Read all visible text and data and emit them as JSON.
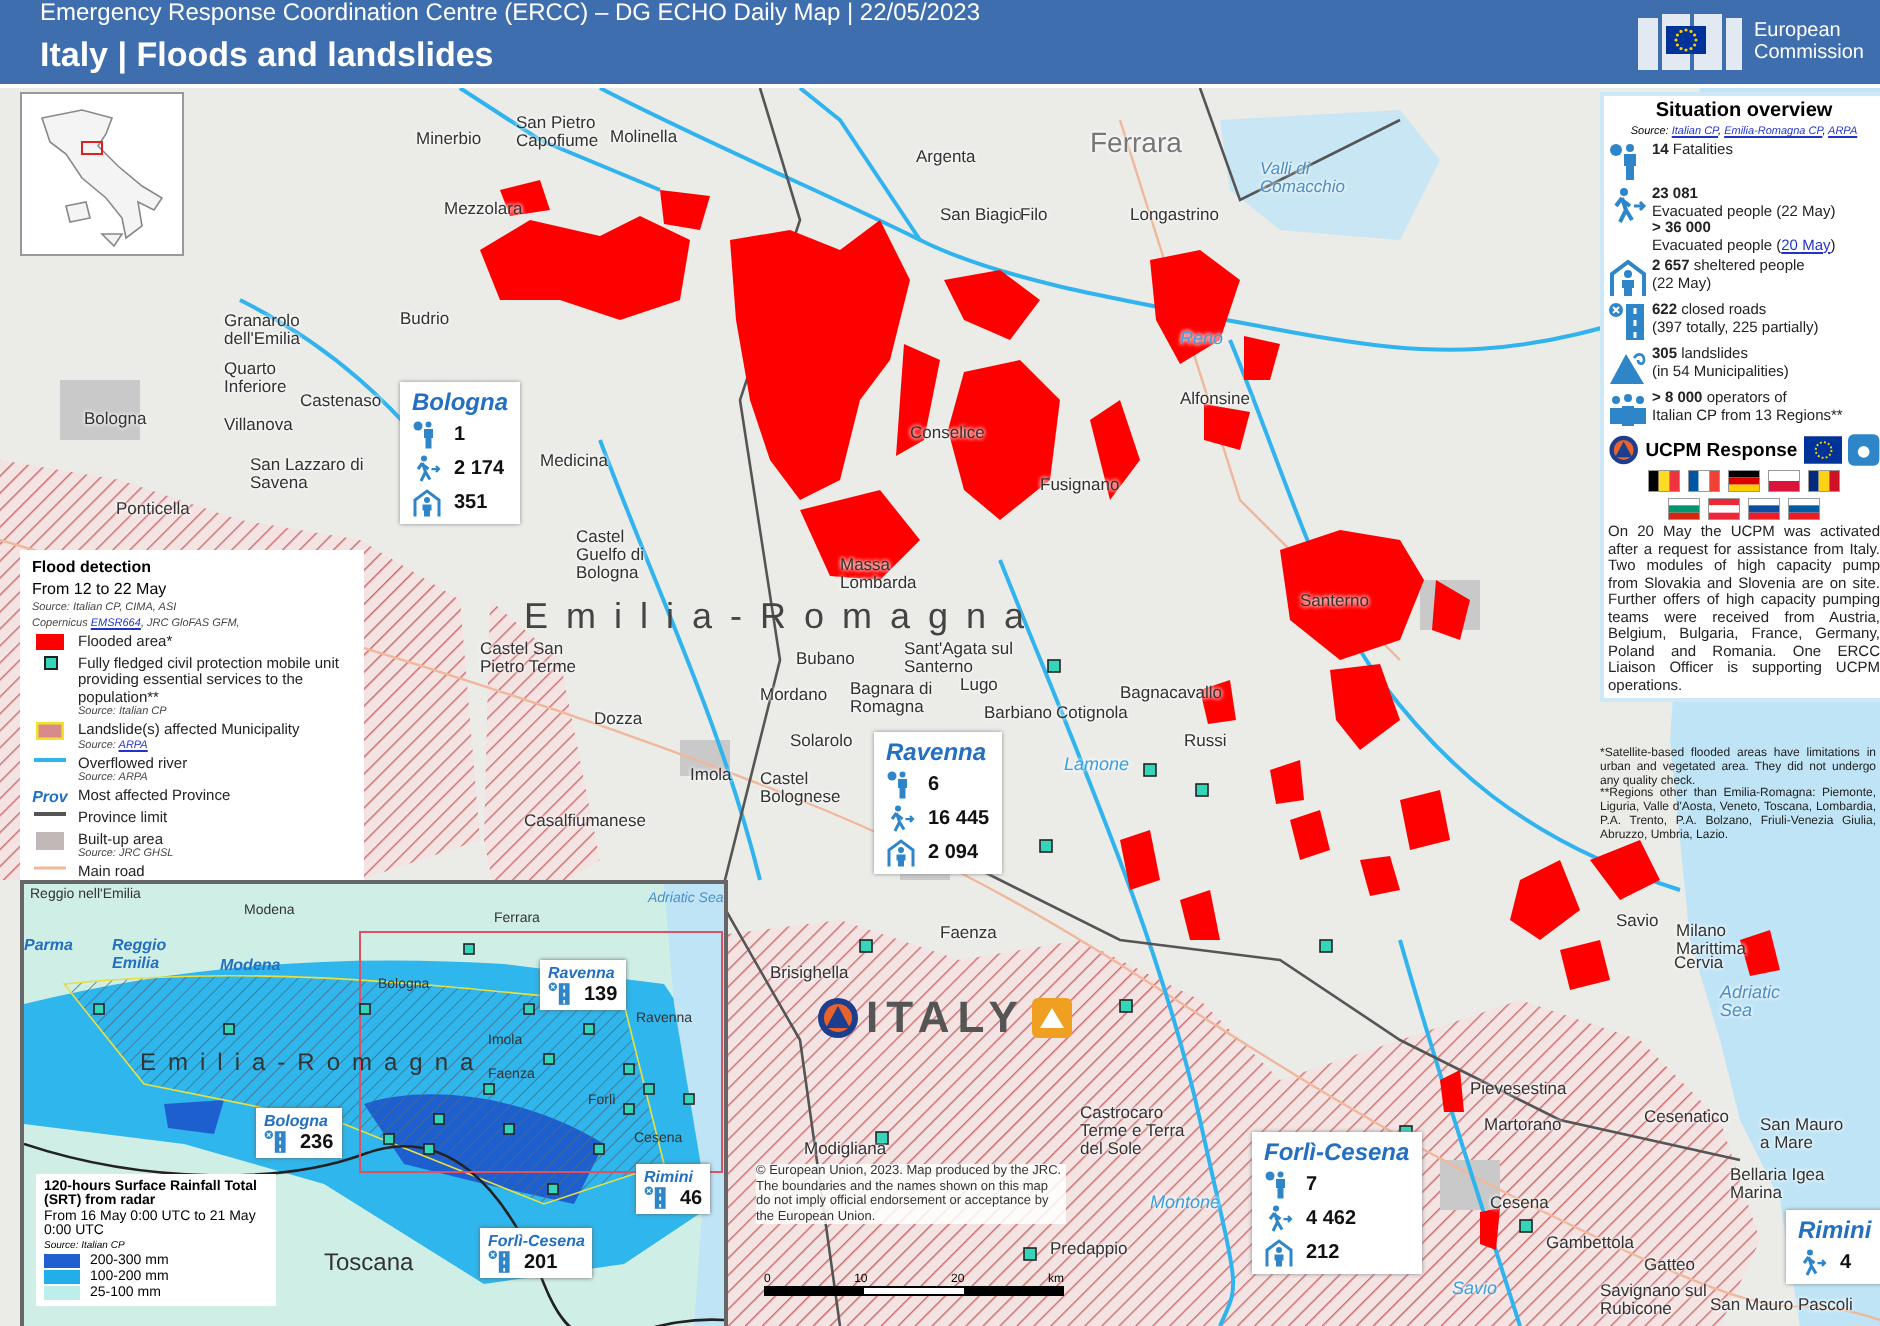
{
  "header": {
    "subtitle": "Emergency Response Coordination Centre (ERCC) – DG ECHO Daily Map | 22/05/2023",
    "title": "Italy | Floods and landslides",
    "logo_lines": [
      "European",
      "Commission"
    ]
  },
  "map": {
    "region_label": "Emilia-Romagna",
    "country_label": "ITALY",
    "places": [
      {
        "name": "Minerbio",
        "kind": "town"
      },
      {
        "name": "San Pietro Capofiume",
        "kind": "town"
      },
      {
        "name": "Molinella",
        "kind": "town"
      },
      {
        "name": "Argenta",
        "kind": "town"
      },
      {
        "name": "Ferrara",
        "kind": "city"
      },
      {
        "name": "Valli di Comacchio",
        "kind": "water"
      },
      {
        "name": "Mezzolara",
        "kind": "town"
      },
      {
        "name": "San Biagio",
        "kind": "town"
      },
      {
        "name": "Filo",
        "kind": "town"
      },
      {
        "name": "Longastrino",
        "kind": "town"
      },
      {
        "name": "Granarolo dell'Emilia",
        "kind": "town"
      },
      {
        "name": "Budrio",
        "kind": "town"
      },
      {
        "name": "Reno",
        "kind": "river"
      },
      {
        "name": "Quarto Inferiore",
        "kind": "town"
      },
      {
        "name": "Bologna",
        "kind": "town"
      },
      {
        "name": "Villanova",
        "kind": "town"
      },
      {
        "name": "Castenaso",
        "kind": "town"
      },
      {
        "name": "Conselice",
        "kind": "town"
      },
      {
        "name": "Alfonsine",
        "kind": "town"
      },
      {
        "name": "San Lazzaro di Savena",
        "kind": "town"
      },
      {
        "name": "Medicina",
        "kind": "town"
      },
      {
        "name": "Fusignano",
        "kind": "town"
      },
      {
        "name": "Ponticella",
        "kind": "town"
      },
      {
        "name": "Castel Guelfo di Bologna",
        "kind": "town"
      },
      {
        "name": "Massa Lombarda",
        "kind": "town"
      },
      {
        "name": "Santerno",
        "kind": "town"
      },
      {
        "name": "Castel San Pietro Terme",
        "kind": "town"
      },
      {
        "name": "Bubano",
        "kind": "town"
      },
      {
        "name": "Sant'Agata sul Santerno",
        "kind": "town"
      },
      {
        "name": "Mordano",
        "kind": "town"
      },
      {
        "name": "Bagnara di Romagna",
        "kind": "town"
      },
      {
        "name": "Lugo",
        "kind": "town"
      },
      {
        "name": "Bagnacavallo",
        "kind": "town"
      },
      {
        "name": "Dozza",
        "kind": "town"
      },
      {
        "name": "Barbiano",
        "kind": "town"
      },
      {
        "name": "Cotignola",
        "kind": "town"
      },
      {
        "name": "Solarolo",
        "kind": "town"
      },
      {
        "name": "Russi",
        "kind": "town"
      },
      {
        "name": "Lamone",
        "kind": "river"
      },
      {
        "name": "Imola",
        "kind": "town"
      },
      {
        "name": "Castel Bolognese",
        "kind": "town"
      },
      {
        "name": "Casalfiumanese",
        "kind": "town"
      },
      {
        "name": "Faenza",
        "kind": "town"
      },
      {
        "name": "Savio",
        "kind": "town"
      },
      {
        "name": "Milano Marittima",
        "kind": "town"
      },
      {
        "name": "Brisighella",
        "kind": "town"
      },
      {
        "name": "Cervia",
        "kind": "town"
      },
      {
        "name": "Adriatic Sea",
        "kind": "sea"
      },
      {
        "name": "Pievesestina",
        "kind": "town"
      },
      {
        "name": "Castrocaro Terme e Terra del Sole",
        "kind": "town"
      },
      {
        "name": "Martorano",
        "kind": "town"
      },
      {
        "name": "Cesenatico",
        "kind": "town"
      },
      {
        "name": "San Mauro a Mare",
        "kind": "town"
      },
      {
        "name": "Modigliana",
        "kind": "town"
      },
      {
        "name": "Bellaria Igea Marina",
        "kind": "town"
      },
      {
        "name": "Montone",
        "kind": "river"
      },
      {
        "name": "Cesena",
        "kind": "town"
      },
      {
        "name": "Predappio",
        "kind": "town"
      },
      {
        "name": "Gambettola",
        "kind": "town"
      },
      {
        "name": "Gatteo",
        "kind": "town"
      },
      {
        "name": "Savio",
        "kind": "river"
      },
      {
        "name": "Savignano sul Rubicone",
        "kind": "town"
      },
      {
        "name": "San Mauro Pascoli",
        "kind": "town"
      }
    ]
  },
  "provinces": [
    {
      "name": "Bologna",
      "stats": [
        {
          "kind": "fatalities",
          "value": "1"
        },
        {
          "kind": "evacuated",
          "value": "2 174"
        },
        {
          "kind": "sheltered",
          "value": "351"
        }
      ]
    },
    {
      "name": "Ravenna",
      "stats": [
        {
          "kind": "fatalities",
          "value": "6"
        },
        {
          "kind": "evacuated",
          "value": "16 445"
        },
        {
          "kind": "sheltered",
          "value": "2 094"
        }
      ]
    },
    {
      "name": "Forlì-Cesena",
      "stats": [
        {
          "kind": "fatalities",
          "value": "7"
        },
        {
          "kind": "evacuated",
          "value": "4 462"
        },
        {
          "kind": "sheltered",
          "value": "212"
        }
      ]
    },
    {
      "name": "Rimini",
      "stats": [
        {
          "kind": "evacuated",
          "value": "4"
        }
      ]
    }
  ],
  "legend": {
    "title": "Flood detection",
    "subtitle": "From 12 to 22 May",
    "sources": [
      [
        {
          "text": "Source: Italian CP, CIMA, ASI"
        }
      ],
      [
        {
          "text": "Copernicus "
        },
        {
          "text": "EMSR664",
          "kind": "link"
        },
        {
          "text": ", JRC GloFAS GFM,"
        }
      ]
    ],
    "items": [
      {
        "kind": "flood",
        "label": "Flooded area*"
      },
      {
        "kind": "unit",
        "label": "Fully fledged civil protection mobile unit providing essential services to the population**",
        "source": [
          {
            "text": "Source: Italian CP"
          }
        ]
      },
      {
        "kind": "landslide",
        "label": "Landslide(s) affected Municipality",
        "source": [
          {
            "text": "Source: "
          },
          {
            "text": "ARPA",
            "kind": "link"
          }
        ]
      },
      {
        "kind": "river",
        "label": "Overflowed river",
        "source": [
          {
            "text": "Source: ARPA"
          }
        ]
      },
      {
        "kind": "prov",
        "symbol": "Prov",
        "label": "Most affected Province"
      },
      {
        "kind": "limit",
        "label": "Province limit"
      },
      {
        "kind": "builtup",
        "label": "Built-up area",
        "source": [
          {
            "text": "Source: JRC GHSL"
          }
        ]
      },
      {
        "kind": "road",
        "label": "Main road"
      }
    ]
  },
  "overview": {
    "title": "Situation overview",
    "source": [
      {
        "text": "Source: "
      },
      {
        "text": "Italian CP",
        "kind": "link"
      },
      {
        "text": ", "
      },
      {
        "text": "Emilia-Romagna CP",
        "kind": "link"
      },
      {
        "text": ", "
      },
      {
        "text": "ARPA",
        "kind": "link"
      }
    ],
    "stats": [
      {
        "kind": "fatalities",
        "lines": [
          [
            {
              "text": "**14** Fatalities"
            }
          ]
        ]
      },
      {
        "kind": "evacuated",
        "lines": [
          [
            {
              "text": "**23 081**"
            }
          ],
          [
            {
              "text": "Evacuated people (22 May)"
            }
          ],
          [
            {
              "text": "**> 36 000**"
            }
          ],
          [
            {
              "text": "Evacuated people ("
            },
            {
              "text": "20 May",
              "kind": "link"
            },
            {
              "text": ")"
            }
          ]
        ]
      },
      {
        "kind": "sheltered",
        "lines": [
          [
            {
              "text": "**2 657** sheltered people"
            }
          ],
          [
            {
              "text": "(22 May)"
            }
          ]
        ]
      },
      {
        "kind": "roads",
        "lines": [
          [
            {
              "text": "**622** closed roads"
            }
          ],
          [
            {
              "text": "(397 totally, 225 partially)"
            }
          ]
        ]
      },
      {
        "kind": "landslides",
        "lines": [
          [
            {
              "text": "**305** landslides"
            }
          ],
          [
            {
              "text": "(in 54 Municipalities)"
            }
          ]
        ]
      },
      {
        "kind": "operators",
        "lines": [
          [
            {
              "text": "**> 8 000** operators of"
            }
          ],
          [
            {
              "text": "Italian CP from 13 Regions**"
            }
          ]
        ]
      }
    ],
    "response_title": "UCPM Response",
    "response_text": "On 20 May the UCPM was activated after a request for assistance from Italy. Two modules of high capacity pump from Slovakia and Slovenia are on site. Further offers of high capacity pumping teams were received from Austria, Belgium, Bulgaria, France, Germany, Poland and Romania. One ERCC Liaison Officer is supporting UCPM operations."
  },
  "footnotes": [
    "*Satellite-based flooded areas have limitations in urban and vegetated area. They did not undergo any quality check.",
    "**Regions other than Emilia-Romagna: Piemonte, Liguria, Valle d'Aosta, Veneto, Toscana, Lombardia, P.A. Trento, P.A. Bolzano, Friuli-Venezia Giulia, Abruzzo, Umbria, Lazio."
  ],
  "inset": {
    "region_label": "Emilia-Romagna",
    "places": [
      {
        "name": "Reggio nell'Emilia",
        "kind": "town"
      },
      {
        "name": "Modena",
        "kind": "town"
      },
      {
        "name": "Ferrara",
        "kind": "town"
      },
      {
        "name": "Adriatic Sea",
        "kind": "sea"
      },
      {
        "name": "Parma",
        "kind": "province"
      },
      {
        "name": "Reggio Emilia",
        "kind": "province"
      },
      {
        "name": "Modena",
        "kind": "province"
      },
      {
        "name": "Bologna",
        "kind": "town"
      },
      {
        "name": "Ravenna",
        "kind": "town"
      },
      {
        "name": "Imola",
        "kind": "town"
      },
      {
        "name": "Faenza",
        "kind": "town"
      },
      {
        "name": "Forlì",
        "kind": "town"
      },
      {
        "name": "Cesena",
        "kind": "town"
      },
      {
        "name": "Toscana",
        "kind": "region"
      }
    ],
    "provinces": [
      {
        "name": "Ravenna",
        "value": "139"
      },
      {
        "name": "Bologna",
        "value": "236"
      },
      {
        "name": "Rimini",
        "value": "46"
      },
      {
        "name": "Forlì-Cesena",
        "value": "201"
      }
    ],
    "legend": {
      "title": "120-hours Surface Rainfall Total (SRT) from radar",
      "subtitle": "From 16 May 0:00 UTC to 21 May 0:00 UTC",
      "source": "Source: Italian CP",
      "items": [
        {
          "label": "200-300 mm",
          "color": "#1f5fd0"
        },
        {
          "label": "100-200 mm",
          "color": "#22aee8"
        },
        {
          "label": "25-100 mm",
          "color": "#bdeee9"
        }
      ]
    }
  },
  "copyright": "© European Union, 2023. Map produced by the JRC. The boundaries and the names shown on this map do not imply official endorsement or acceptance by the European Union.",
  "scale": {
    "ticks": [
      "0",
      "10",
      "20"
    ],
    "unit": "km"
  }
}
